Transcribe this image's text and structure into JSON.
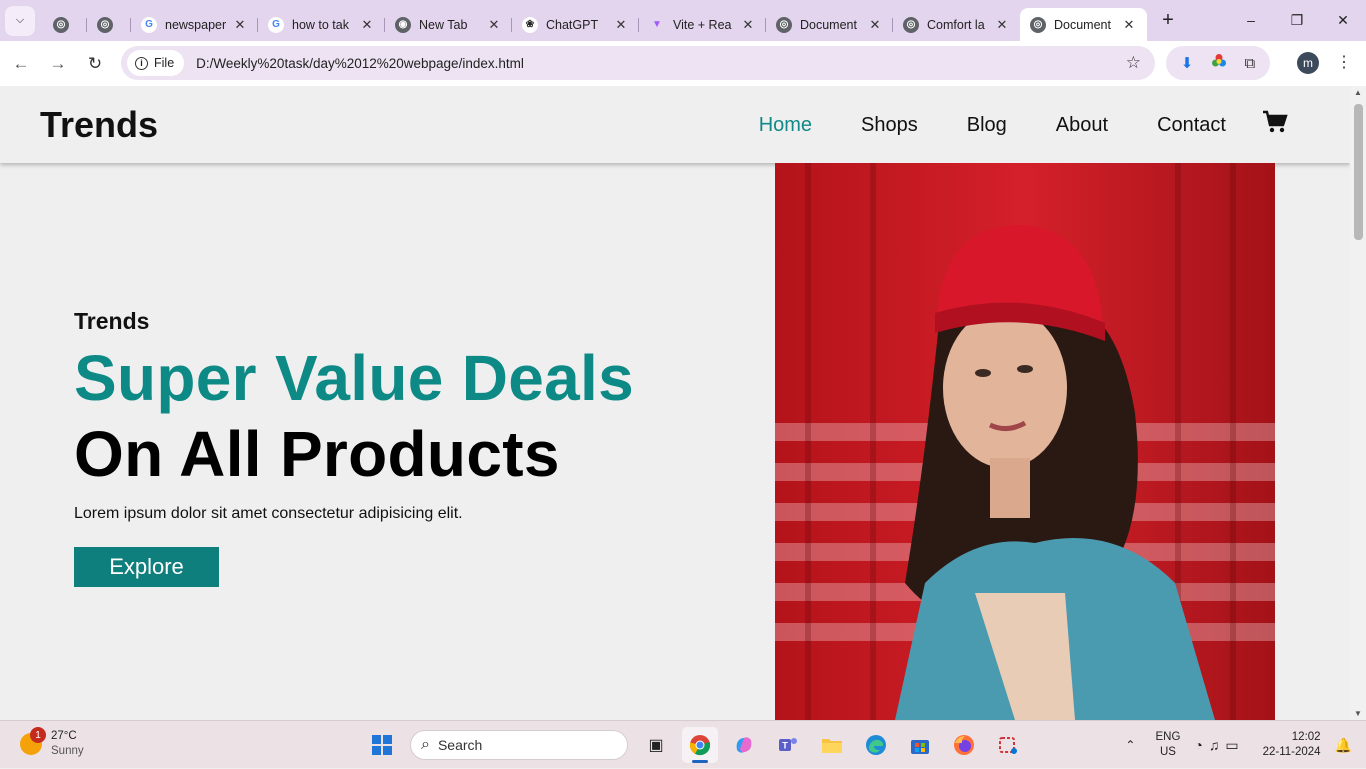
{
  "browser": {
    "tabs": [
      {
        "title": "",
        "icon": "globe-icon",
        "closable": false,
        "small": true
      },
      {
        "title": "",
        "icon": "globe-icon",
        "closable": false,
        "small": true
      },
      {
        "title": "newspaper",
        "icon": "google-icon",
        "closable": true
      },
      {
        "title": "how to tak",
        "icon": "google-icon",
        "closable": true
      },
      {
        "title": "New Tab",
        "icon": "chrome-icon",
        "closable": true
      },
      {
        "title": "ChatGPT",
        "icon": "chatgpt-icon",
        "closable": true
      },
      {
        "title": "Vite + Rea",
        "icon": "vite-icon",
        "closable": true
      },
      {
        "title": "Document",
        "icon": "globe-icon",
        "closable": true
      },
      {
        "title": "Comfort la",
        "icon": "globe-icon",
        "closable": true
      },
      {
        "title": "Document",
        "icon": "globe-icon",
        "closable": true,
        "active": true
      }
    ],
    "address": {
      "chip_label": "File",
      "url": "D:/Weekly%20task/day%2012%20webpage/index.html"
    },
    "profile_initial": "m"
  },
  "site": {
    "brand": "Trends",
    "nav": [
      "Home",
      "Shops",
      "Blog",
      "About",
      "Contact"
    ],
    "active_nav": "Home",
    "accent": "#11898a",
    "hero": {
      "kicker": "Trends",
      "headline_1": "Super Value Deals",
      "headline_2": "On All Products",
      "lead": "Lorem ipsum dolor sit amet consectetur adipisicing elit.",
      "cta": "Explore"
    }
  },
  "taskbar": {
    "weather": {
      "temp": "27°C",
      "condition": "Sunny",
      "badge": "1"
    },
    "search_placeholder": "Search",
    "lang": {
      "line1": "ENG",
      "line2": "US"
    },
    "clock": {
      "time": "12:02",
      "date": "22-11-2024"
    }
  }
}
